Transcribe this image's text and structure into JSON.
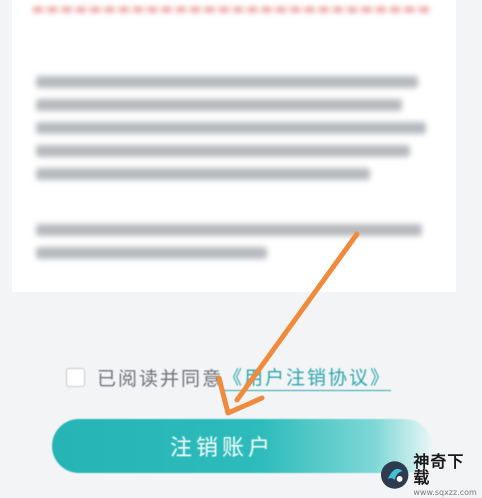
{
  "agreement": {
    "prefix": "已阅读并同意",
    "link": "《用户注销协议》"
  },
  "actions": {
    "cancel_account": "注销账户"
  },
  "watermark": {
    "title": "神奇下载",
    "url": "www.sqxzz.com"
  },
  "colors": {
    "accent": "#2bb5b4",
    "arrow": "#f08a3c",
    "link": "#2ba6ad"
  }
}
